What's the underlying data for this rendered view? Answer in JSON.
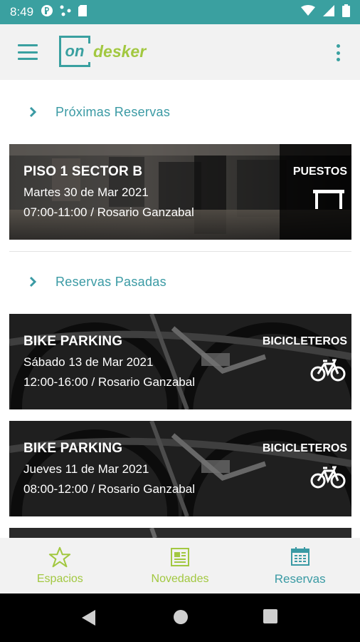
{
  "status_bar": {
    "time": "8:49",
    "background": "#3aa0a0"
  },
  "app": {
    "logo_on": "on",
    "logo_desker": "desker",
    "accent": "#3aa0a0",
    "brand_green": "#a2c840"
  },
  "sections": {
    "upcoming_label": "Próximas Reservas",
    "past_label": "Reservas Pasadas"
  },
  "upcoming": [
    {
      "title": "PISO 1 SECTOR B",
      "date": "Martes 30 de Mar 2021",
      "detail": "07:00-11:00 / Rosario Ganzabal",
      "type": "PUESTOS",
      "icon": "desk-icon"
    }
  ],
  "past": [
    {
      "title": "BIKE PARKING",
      "date": "Sábado 13 de Mar 2021",
      "detail": "12:00-16:00 / Rosario Ganzabal",
      "type": "BICICLETEROS",
      "icon": "bicycle-icon"
    },
    {
      "title": "BIKE PARKING",
      "date": "Jueves 11 de Mar 2021",
      "detail": "08:00-12:00 / Rosario Ganzabal",
      "type": "BICICLETEROS",
      "icon": "bicycle-icon"
    }
  ],
  "bottom_nav": {
    "items": [
      {
        "label": "Espacios",
        "icon": "star-icon"
      },
      {
        "label": "Novedades",
        "icon": "newspaper-icon"
      },
      {
        "label": "Reservas",
        "icon": "calendar-icon"
      }
    ],
    "active": "Reservas"
  }
}
